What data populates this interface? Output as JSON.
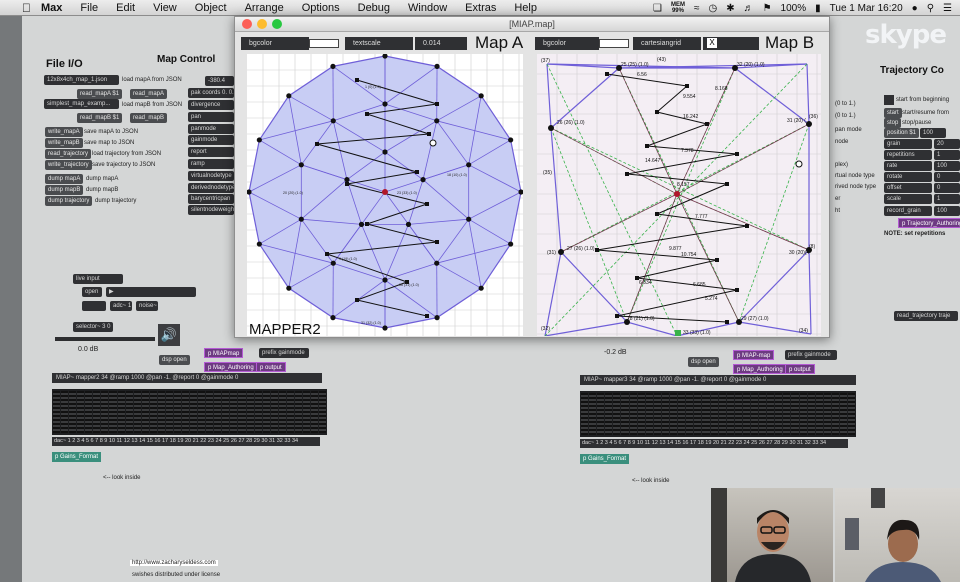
{
  "menubar": {
    "app": "Max",
    "items": [
      "File",
      "Edit",
      "View",
      "Object",
      "Arrange",
      "Options",
      "Debug",
      "Window",
      "Extras",
      "Help"
    ],
    "battery": "100%",
    "datetime": "Tue 1 Mar 16:20",
    "mem_label": "MEM",
    "mem_value": "99%"
  },
  "skype_logo": "skype",
  "left_patcher": {
    "file_io_title": "File I/O",
    "map_control_title": "Map Control",
    "map_a_file": "12x8x4ch_map_1.json",
    "map_b_file": "simplest_map_examp...",
    "buttons": [
      {
        "msg": "read_mapA $1",
        "cmt": "load mapA from JSON"
      },
      {
        "msg": "read_mapA",
        "cmt": ""
      },
      {
        "msg": "read_mapB $1",
        "cmt": "load mapB from JSON"
      },
      {
        "msg": "read_mapB",
        "cmt": ""
      },
      {
        "msg": "write_mapA",
        "cmt": "save mapA to JSON"
      },
      {
        "msg": "write_mapB",
        "cmt": "save map to JSON"
      },
      {
        "msg": "read_trajectory",
        "cmt": "load trajectory from JSON"
      },
      {
        "msg": "write_trajectory",
        "cmt": "save trajectory to JSON"
      },
      {
        "msg": "dump mapA",
        "cmt": "dump mapA"
      },
      {
        "msg": "dump mapB",
        "cmt": "dump mapB"
      },
      {
        "msg": "dump trajectory",
        "cmt": "dump trajectory"
      }
    ],
    "map_control_boxes": [
      "-380.4",
      "pak coords 0. 0.",
      "divergence",
      "pan",
      "panmode",
      "gainmode",
      "report",
      "ramp",
      "virtualnodetype",
      "derivednodetype",
      "barycentricpan",
      "silentnodeweight"
    ],
    "live_input": "live input",
    "open": "open",
    "adc": "adc~ 1",
    "noise": "noise~",
    "selector": "selector~ 3 0",
    "gain_db": "0.0 dB",
    "dsp_open": "dsp open",
    "p_miap": "p MIAPmap",
    "prefix": "prefix gainmode",
    "p_map_authoring": "p Map_Authoring",
    "p_output": "p output",
    "mapper_obj": "MIAP~ mapper2 34 @ramp 1000 @pan -1. @report 0 @gainmode 0",
    "dac_label": "dac~ 1 2 3 4 5 6 7 8 9 10 11 12 13 14 15 16 17 18 19 20 21 22 23 24 25 26 27 28 29 30 31 32 33 34",
    "p_gains": "p Gains_Format",
    "look_inside": "<-- look inside",
    "url": "http://www.zacharyseldess.com",
    "license": "swishes distributed under license"
  },
  "right_patcher": {
    "trajectory_title": "Trajectory Co",
    "start_cmt": "start from beginning",
    "start_msg": "start",
    "start_cmt2": "start/resume from",
    "stop_msg": "stop",
    "stop_cmt": "stop/pause",
    "position_msg": "position $1",
    "position_val": "100",
    "rows": [
      {
        "label": "grain",
        "val": "20"
      },
      {
        "label": "repetitions",
        "val": "1"
      },
      {
        "label": "rate",
        "val": "100"
      },
      {
        "label": "rotate",
        "val": "0"
      },
      {
        "label": "offset",
        "val": "0"
      },
      {
        "label": "scale",
        "val": "1"
      },
      {
        "label": "record_grain",
        "val": "100"
      }
    ],
    "p_traj": "p Trajectory_Authoring",
    "note": "NOTE: set repetitions",
    "side_cmts": [
      "(0 to 1.)",
      "(0 to 1.)",
      "pan mode",
      "node",
      "plex)",
      "rtual node type",
      "rived node type",
      "er",
      "ht"
    ],
    "read_traj": "read_trajectory traje",
    "mapper_obj": "MIAP~ mapper3 34 @ramp 1000 @pan -1. @report 0 @gainmode 0",
    "gain_db": "-0.2 dB",
    "dsp_open": "dsp open",
    "p_miap": "p MIAP-map",
    "prefix": "prefix gainmode",
    "p_map_authoring": "p Map_Authoring",
    "p_output": "p output",
    "dac_label": "dac~ 1 2 3 4 5 6 7 8 9 10 11 12 13 14 15 16 17 18 19 20 21 22 23 24 25 26 27 28 29 30 31 32 33 34",
    "p_gains": "p Gains_Format",
    "look_inside": "<-- look inside"
  },
  "map_window": {
    "title": "[MIAP.map]",
    "map_a": {
      "bg_label": "bgcolor",
      "textscale_label": "textscale",
      "textscale_value": "0.014",
      "name": "Map A",
      "bg_color": "#c8cdf4"
    },
    "map_b": {
      "bg_label": "bgcolor",
      "grid_label": "cartesiangrid",
      "grid_check": "X",
      "name": "Map B"
    },
    "footer": "MAPPER2",
    "map_a_labels": [
      "1 (0) (1.0)",
      "20 (20) (1.0)",
      "18 (10) (1.0)",
      "23 (33) (1.0)",
      "9 (19) (1.0)",
      "16 (31) (1.0)",
      "31 (32) (1.0)"
    ],
    "map_b_labels": {
      "nodes": [
        "(37)",
        "25 (25) (1.0)",
        "32 (20) (1.0)",
        "26 (26) (1.0)",
        "31 (20) (",
        "27 (26) (1.0)",
        "30 (20)(4",
        "28 (21) (1.0)",
        "29 (27) (1.0)",
        "33 (33) (1.0)",
        "(32)",
        "(35)",
        "(36)",
        "(34)",
        "(31)",
        "(43)",
        "(8)"
      ],
      "dists": [
        "6.56",
        "9.554",
        "8.168",
        "16.242",
        "14.647",
        "7.378",
        "8.157",
        "7.777",
        "9.877",
        "10.754",
        "6.685",
        "5.274",
        "6.834"
      ]
    },
    "accent_line": "#2b2bb8",
    "dash_color": "#38b24a",
    "edge_color": "#6f5fd8"
  }
}
